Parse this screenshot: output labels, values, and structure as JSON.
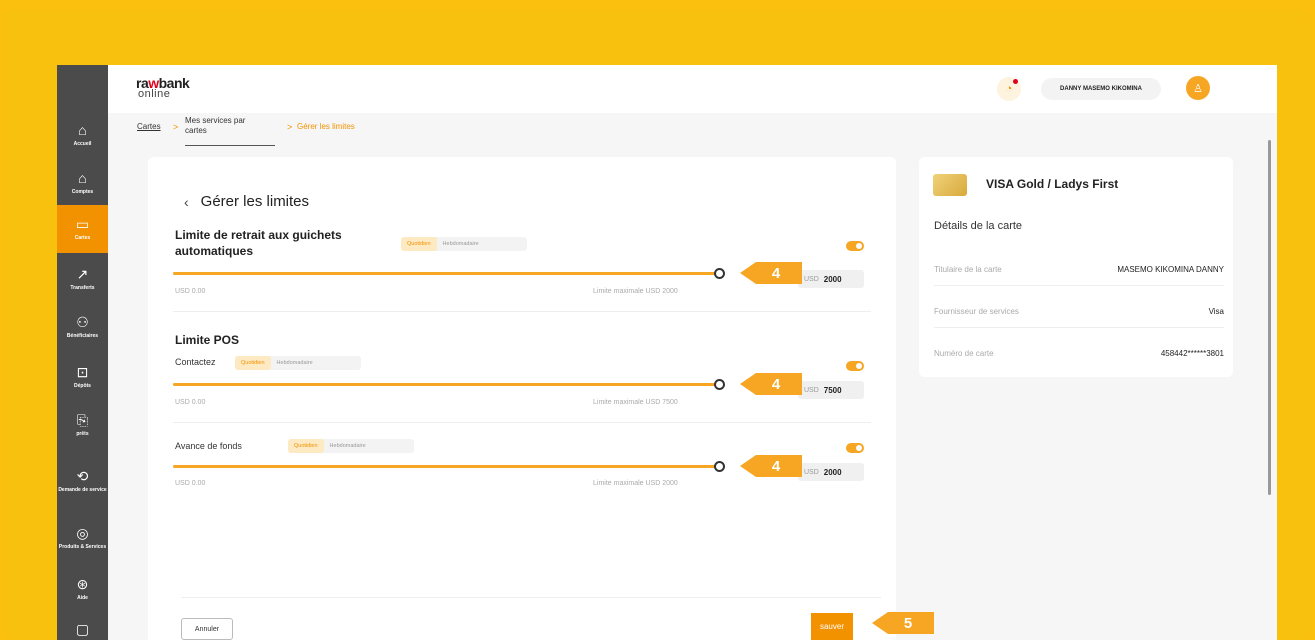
{
  "sidebar": {
    "items": [
      {
        "label": "Accueil",
        "icon": "home-icon",
        "glyph": "⌂"
      },
      {
        "label": "Comptes",
        "icon": "bank-icon",
        "glyph": "🏛"
      },
      {
        "label": "Cartes",
        "icon": "card-icon",
        "glyph": "▭",
        "active": true
      },
      {
        "label": "Transferts",
        "icon": "arrow-up-right-icon",
        "glyph": "↗"
      },
      {
        "label": "Bénéficiaires",
        "icon": "users-icon",
        "glyph": "⚇"
      },
      {
        "label": "Dépôts",
        "icon": "deposit-icon",
        "glyph": "⊡"
      },
      {
        "label": "prêts",
        "icon": "loan-icon",
        "glyph": "⎘"
      },
      {
        "label": "Demande de service",
        "icon": "service-request-icon",
        "glyph": "⟲"
      },
      {
        "label": "Produits & Services",
        "icon": "products-icon",
        "glyph": "◎"
      },
      {
        "label": "Aide",
        "icon": "help-icon",
        "glyph": "⊛"
      },
      {
        "label": "",
        "icon": "chat-icon",
        "glyph": "▢"
      }
    ]
  },
  "header": {
    "logo_line1_a": "ra",
    "logo_line1_b": "w",
    "logo_line1_c": "bank",
    "logo_line2": "online",
    "user_name": "DANNY MASEMO KIKOMINA",
    "bell_glyph": "🔔",
    "avatar_glyph": "☺"
  },
  "breadcrumb": {
    "item1": "Cartes",
    "item2_line1": "Mes services par",
    "item2_line2": "cartes",
    "item3": "Gérer les limites",
    "sep": ">"
  },
  "main": {
    "back_glyph": "‹",
    "title": "Gérer les limites",
    "period_on": "Quotidien",
    "period_off": "Hebdomadaire",
    "atm": {
      "title_line1": "Limite de retrait aux guichets",
      "title_line2": "automatiques",
      "min_label": "USD 0.00",
      "max_label": "Limite maximale USD 2000",
      "currency": "USD",
      "value": "2000",
      "fill": 1.0
    },
    "pos": {
      "title": "Limite POS",
      "contactless_label": "Contactez",
      "contactless_min": "USD 0.00",
      "contactless_max": "Limite maximale USD 7500",
      "contactless_currency": "USD",
      "contactless_value": "7500",
      "cash_label": "Avance de fonds",
      "cash_min": "USD 0.00",
      "cash_max": "Limite maximale USD 2000",
      "cash_currency": "USD",
      "cash_value": "2000"
    },
    "cancel_label": "Annuler",
    "save_label": "sauver"
  },
  "callouts": {
    "step4": "4",
    "step5": "5"
  },
  "card_panel": {
    "title": "VISA Gold / Ladys First",
    "subtitle": "Détails de la carte",
    "rows": [
      {
        "key": "Titulaire de la carte",
        "value": "MASEMO KIKOMINA DANNY"
      },
      {
        "key": "Fournisseur de services",
        "value": "Visa"
      },
      {
        "key": "Numéro de carte",
        "value": "458442******3801"
      }
    ]
  },
  "colors": {
    "accent": "#f39200",
    "background": "#fbbf0e",
    "sidebar": "#4b4b4b"
  }
}
